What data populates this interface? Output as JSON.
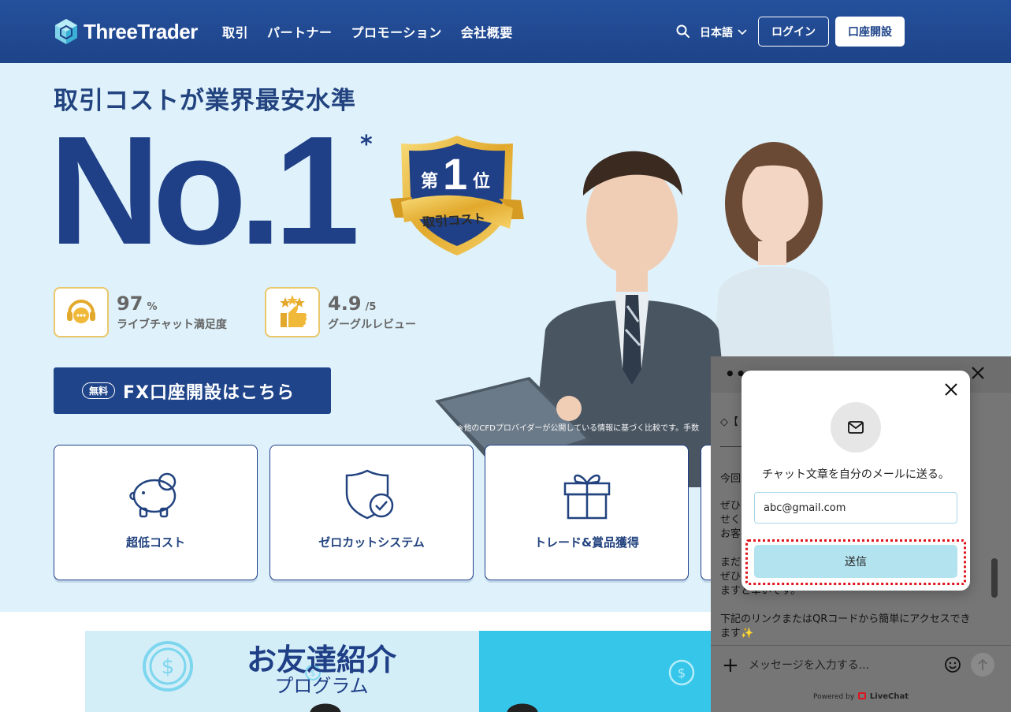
{
  "brand": {
    "name": "ThreeTrader"
  },
  "nav": {
    "items": [
      "取引",
      "パートナー",
      "プロモーション",
      "会社概要"
    ]
  },
  "header": {
    "language": "日本語",
    "login": "ログイン",
    "open_account": "口座開設"
  },
  "hero": {
    "title": "取引コストが業界最安水準",
    "big": "No.1",
    "asterisk": "*",
    "badge": {
      "prefix": "第",
      "number": "1",
      "suffix": "位",
      "ribbon": "取引コスト"
    },
    "stats": [
      {
        "value": "97",
        "unit": "%",
        "label": "ライブチャット満足度"
      },
      {
        "value": "4.9",
        "unit": "/5",
        "label": "グーグルレビュー"
      }
    ],
    "cta": {
      "tag": "無料",
      "text": "FX口座開設はこちら"
    },
    "disclaimer": "※他のCFDプロバイダーが公開している情報に基づく比較です。手数"
  },
  "features": [
    {
      "label": "超低コスト",
      "icon": "piggy-bank-icon"
    },
    {
      "label": "ゼロカットシステム",
      "icon": "shield-check-icon"
    },
    {
      "label": "トレード&賞品獲得",
      "icon": "gift-icon"
    }
  ],
  "promo": {
    "title": "お友達紹介",
    "subtitle": "プログラム"
  },
  "chat": {
    "lines": [
      "◇【",
      "今回",
      "ぜひ、",
      "せくだ",
      "お客",
      "まだ",
      "ぜひ",
      "ますと幸いです。",
      "下記のリンクまたはQRコードから簡単にアクセスでき",
      "ます✨"
    ],
    "input_placeholder": "メッセージを入力する...",
    "powered_prefix": "Powered by",
    "powered_brand": "LiveChat"
  },
  "modal": {
    "text": "チャット文章を自分のメールに送る。",
    "email_value": "abc@gmail.com",
    "submit": "送信"
  },
  "colors": {
    "navy": "#1f3f86",
    "header": "#22509c",
    "hero_bg": "#dff2fb",
    "highlight": "#e0141c",
    "submit_bg": "#b3e3ef"
  }
}
